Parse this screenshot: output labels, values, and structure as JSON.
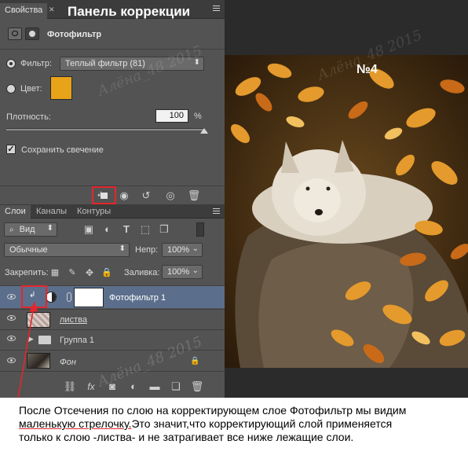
{
  "panel": {
    "tab_label": "Свойства",
    "title": "Панель коррекции",
    "header_label": "Фотофильтр",
    "filter_label": "Фильтр:",
    "filter_value": "Теплый фильтр (81)",
    "color_label": "Цвет:",
    "color_swatch": "#e8a318",
    "density_label": "Плотность:",
    "density_value": "100",
    "density_unit": "%",
    "density_level": 1.0,
    "preserve_label": "Сохранить свечение"
  },
  "layers": {
    "tabs": [
      "Слои",
      "Каналы",
      "Контуры"
    ],
    "kind_select": "Вид",
    "blend_mode": "Обычные",
    "opacity_label": "Непр:",
    "opacity_value": "100%",
    "lock_label": "Закрепить:",
    "fill_label": "Заливка:",
    "fill_value": "100%",
    "rows": [
      {
        "name": "Фотофильтр 1",
        "selected": true
      },
      {
        "name": "листва",
        "selected": false
      },
      {
        "name": "Группа 1",
        "selected": false
      },
      {
        "name": "Фон",
        "selected": false
      }
    ]
  },
  "photo": {
    "number_label": "№4"
  },
  "watermark": "Алёна_48 2015",
  "caption": {
    "line1": "После Отсечения по слою на корректирующем слое Фотофильтр мы видим",
    "line2_underlined": "маленькую стрелочку.",
    "line2_rest": "Это значит,что корректирующий слой применяется",
    "line3": "только к слою -листва- и не затрагивает все ниже лежащие слои."
  },
  "colors": {
    "highlight": "#e3262b",
    "panel_bg": "#535353",
    "selected_row": "#5b6f8c"
  }
}
